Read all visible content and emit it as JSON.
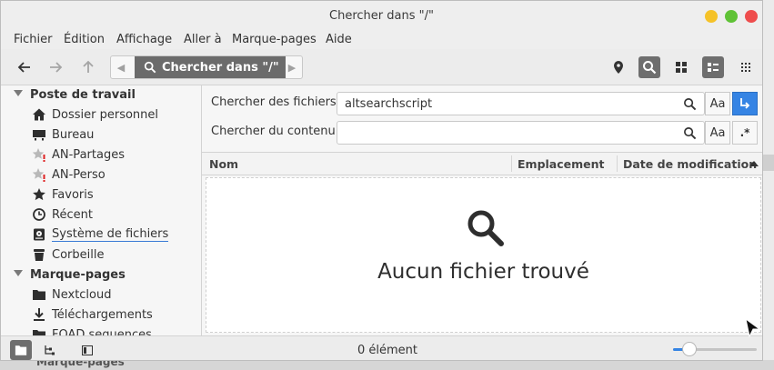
{
  "window": {
    "title": "Chercher dans \"/\""
  },
  "menubar": [
    "Fichier",
    "Édition",
    "Affichage",
    "Aller à",
    "Marque-pages",
    "Aide"
  ],
  "pathbar": {
    "crumb": "Chercher dans \"/\""
  },
  "sidebar": {
    "sections": [
      {
        "title": "Poste de travail",
        "items": [
          {
            "label": "Dossier personnel",
            "icon": "home-icon"
          },
          {
            "label": "Bureau",
            "icon": "desktop-icon"
          },
          {
            "label": "AN-Partages",
            "icon": "star-warning-icon"
          },
          {
            "label": "AN-Perso",
            "icon": "star-warning-icon"
          },
          {
            "label": "Favoris",
            "icon": "star-icon"
          },
          {
            "label": "Récent",
            "icon": "clock-icon"
          },
          {
            "label": "Système de fichiers",
            "icon": "drive-icon"
          },
          {
            "label": "Corbeille",
            "icon": "trash-icon"
          }
        ]
      },
      {
        "title": "Marque-pages",
        "items": [
          {
            "label": "Nextcloud",
            "icon": "folder-icon"
          },
          {
            "label": "Téléchargements",
            "icon": "download-icon"
          },
          {
            "label": "FOAD sequences",
            "icon": "folder-icon"
          }
        ]
      }
    ]
  },
  "search": {
    "files_label": "Chercher des fichiers :",
    "files_value": "altsearchscript",
    "content_label": "Chercher du contenu :",
    "content_value": "",
    "case_btn": "Aa",
    "regex_btn": ".*"
  },
  "columns": [
    "Nom",
    "Emplacement",
    "Date de modification"
  ],
  "results": {
    "empty_text": "Aucun fichier trouvé"
  },
  "status": {
    "text": "0 élément",
    "zoom_fraction": 0.2
  },
  "background": {
    "peek_text": "Marque-pages"
  },
  "colors": {
    "accent": "#3584e4",
    "active_button": "#6e6e6e"
  }
}
